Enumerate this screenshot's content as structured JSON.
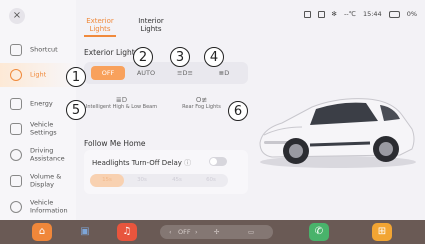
{
  "window": {
    "close_glyph": "×"
  },
  "status_bar": {
    "temperature": "--℃",
    "time": "15:44",
    "battery": "0%"
  },
  "tabs": [
    {
      "label": "Exterior Lights",
      "active": true
    },
    {
      "label": "Interior Lights",
      "active": false
    }
  ],
  "sidebar": {
    "items": [
      {
        "label": "Shortcut",
        "icon": "link-icon",
        "active": false
      },
      {
        "label": "Light",
        "icon": "bulb-icon",
        "active": true
      },
      {
        "label": "Energy",
        "icon": "battery-icon",
        "active": false
      },
      {
        "label": "Vehicle Settings",
        "icon": "car-icon",
        "active": false
      },
      {
        "label": "Driving Assistance",
        "icon": "steering-wheel-icon",
        "active": false
      },
      {
        "label": "Volume & Display",
        "icon": "speaker-icon",
        "active": false
      },
      {
        "label": "Vehicle Information",
        "icon": "info-icon",
        "active": false
      }
    ]
  },
  "exterior_light": {
    "title": "Exterior Light",
    "modes": [
      {
        "label": "OFF",
        "selected": true
      },
      {
        "label": "AUTO",
        "selected": false
      },
      {
        "label": "≡D≡",
        "selected": false
      },
      {
        "label": "≣D",
        "selected": false
      }
    ],
    "options": [
      {
        "label": "Intelligent High & Low Beam",
        "icon": "high-beam-icon"
      },
      {
        "label": "Rear Fog Lights",
        "icon": "rear-fog-icon"
      }
    ]
  },
  "follow_me_home": {
    "title": "Follow Me Home",
    "delay_label": "Headlights Turn-Off Delay",
    "toggle_on": false,
    "durations": [
      "15s",
      "30s",
      "45s",
      "60s"
    ]
  },
  "callouts": [
    "1",
    "2",
    "3",
    "4",
    "5",
    "6"
  ],
  "dock": {
    "center_left": "‹",
    "center_status": "OFF",
    "center_right": "›",
    "colors": {
      "home": "#f0873a",
      "car": "#4a7fc1",
      "music": "#e8553d",
      "phone": "#49b36b",
      "apps": "#f2a533"
    }
  }
}
